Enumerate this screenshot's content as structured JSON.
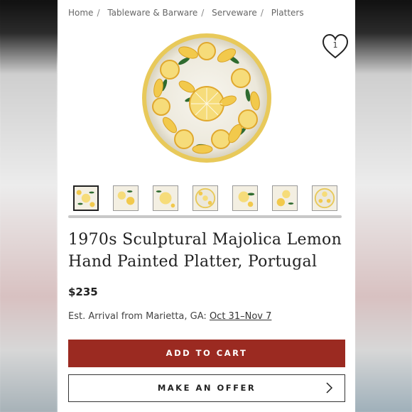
{
  "breadcrumb": [
    "Home",
    "Tableware & Barware",
    "Serveware",
    "Platters"
  ],
  "favorite": {
    "icon": "heart-icon",
    "count": "1"
  },
  "gallery": {
    "thumbnail_count": 7,
    "active_index": 0
  },
  "product": {
    "title": "1970s Sculptural Majolica Lemon Hand Painted Platter, Portugal",
    "price": "$235",
    "arrival_label": "Est. Arrival from Marietta, GA:",
    "arrival_dates": "Oct 31–Nov 7"
  },
  "actions": {
    "add_to_cart": "ADD TO CART",
    "make_offer": "MAKE AN OFFER",
    "make_offer_icon": "chevron-right-icon"
  },
  "colors": {
    "cart_button": "#9b2a21",
    "lemon": "#f2c94c",
    "leaf": "#2f6b2f"
  }
}
